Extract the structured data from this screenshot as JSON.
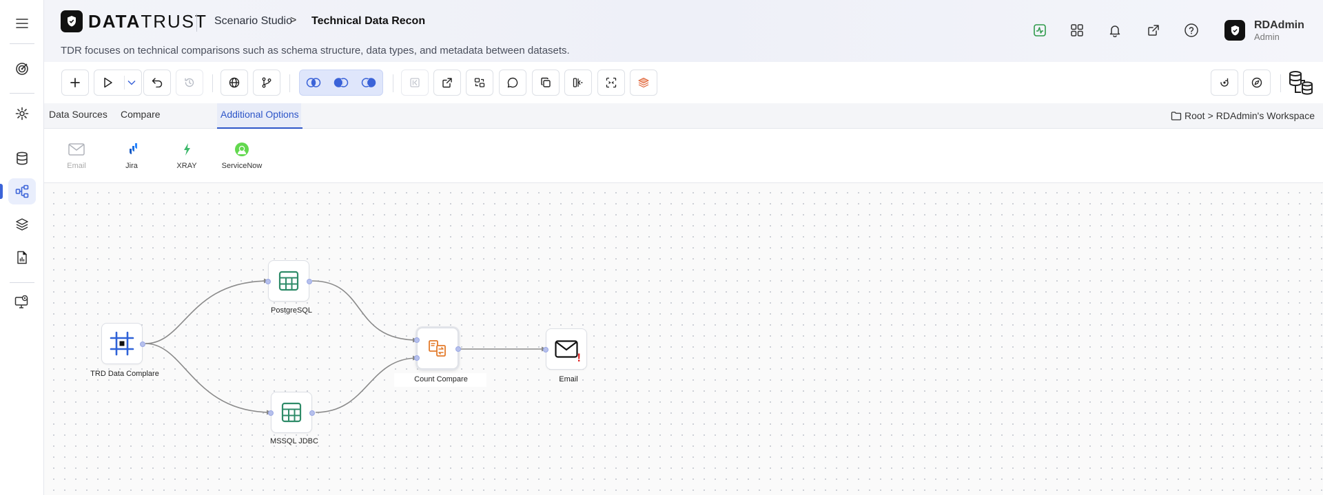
{
  "header": {
    "brand_bold": "DATA",
    "brand_light": "TRUST",
    "breadcrumb_parent": "Scenario Studio",
    "breadcrumb_sep": ">",
    "breadcrumb_current": "Technical Data Recon",
    "description": "TDR focuses on technical comparisons such as schema structure, data types, and metadata between datasets.",
    "user_name": "RDAdmin",
    "user_role": "Admin",
    "icons": [
      "activity-icon",
      "apps-grid-icon",
      "bell-icon",
      "external-link-icon",
      "help-icon"
    ]
  },
  "sidebar": {
    "items": [
      "menu-icon",
      "target-icon",
      "settings-icon",
      "database-icon",
      "flow-icon",
      "layers-icon",
      "report-icon",
      "monitor-icon"
    ],
    "active": "flow-icon"
  },
  "tabs": {
    "items": [
      "Data Sources",
      "Compare",
      "Additional Options"
    ],
    "active": "Additional Options"
  },
  "workspace": {
    "root": "Root",
    "sep": ">",
    "name": "RDAdmin's Workspace"
  },
  "options": [
    {
      "label": "Email",
      "icon": "mail-icon",
      "disabled": true
    },
    {
      "label": "Jira",
      "icon": "jira-icon",
      "disabled": false
    },
    {
      "label": "XRAY",
      "icon": "xray-icon",
      "disabled": false
    },
    {
      "label": "ServiceNow",
      "icon": "servicenow-icon",
      "disabled": false
    }
  ],
  "nodes": [
    {
      "id": "trd",
      "label": "TRD Data Complare"
    },
    {
      "id": "pg",
      "label": "PostgreSQL"
    },
    {
      "id": "ms",
      "label": "MSSQL JDBC"
    },
    {
      "id": "cc",
      "label": "Count Compare"
    },
    {
      "id": "em",
      "label": "Email",
      "badge": "!"
    }
  ],
  "colors": {
    "accent": "#2d55c8",
    "node_port": "#b6c0ec",
    "table_icon": "#2e8b68",
    "compare_icon": "#e37a2a",
    "alert": "#e02020",
    "activity_icon": "#2e9a4a"
  }
}
